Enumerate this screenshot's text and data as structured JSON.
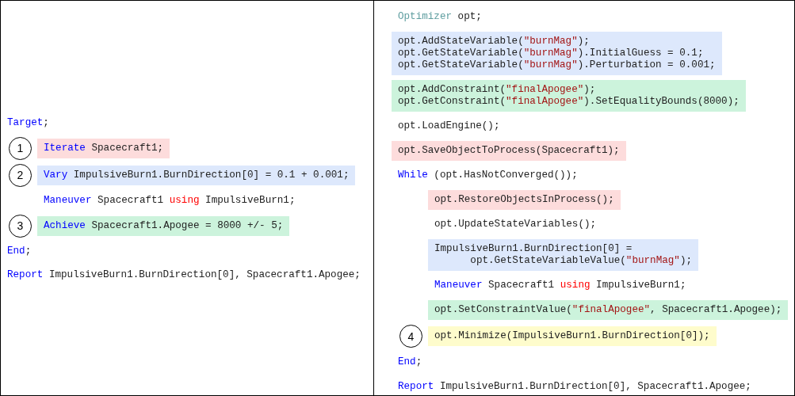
{
  "panels": [
    {
      "blocks": [
        {
          "lines": [
            [
              {
                "text": "Target",
                "kind": "keyword"
              },
              {
                "text": ";",
                "kind": "plain"
              }
            ]
          ],
          "children": [
            {
              "step": "1",
              "color": "#fddcdc",
              "lines": [
                [
                  {
                    "text": "Iterate",
                    "kind": "keyword"
                  },
                  {
                    "text": " Spacecraft1;",
                    "kind": "plain"
                  }
                ]
              ]
            },
            {
              "step": "2",
              "color": "#dde8fc",
              "lines": [
                [
                  {
                    "text": "Vary",
                    "kind": "keyword"
                  },
                  {
                    "text": " ImpulsiveBurn1.BurnDirection[0] = 0.1 + 0.001;",
                    "kind": "plain"
                  }
                ]
              ]
            },
            {
              "lines": [
                [
                  {
                    "text": "Maneuver",
                    "kind": "keyword"
                  },
                  {
                    "text": " Spacecraft1 ",
                    "kind": "plain"
                  },
                  {
                    "text": "using",
                    "kind": "operator"
                  },
                  {
                    "text": " ImpulsiveBurn1;",
                    "kind": "plain"
                  }
                ]
              ]
            },
            {
              "step": "3",
              "color": "#ccf3dc",
              "lines": [
                [
                  {
                    "text": "Achieve",
                    "kind": "keyword"
                  },
                  {
                    "text": " Spacecraft1.Apogee = 8000 +/- 5;",
                    "kind": "plain"
                  }
                ]
              ]
            }
          ]
        },
        {
          "lines": [
            [
              {
                "text": "End",
                "kind": "keyword"
              },
              {
                "text": ";",
                "kind": "plain"
              }
            ]
          ]
        },
        {
          "lines": [
            [
              {
                "text": "Report",
                "kind": "keyword"
              },
              {
                "text": " ImpulsiveBurn1.BurnDirection[0], Spacecraft1.Apogee;",
                "kind": "plain"
              }
            ]
          ]
        }
      ]
    },
    {
      "blocks": [
        {
          "lines": [
            [
              {
                "text": "Optimizer",
                "kind": "type"
              },
              {
                "text": " opt;",
                "kind": "plain"
              }
            ]
          ]
        },
        {
          "color": "#dde8fc",
          "lines": [
            [
              {
                "text": "opt.AddStateVariable(",
                "kind": "plain"
              },
              {
                "text": "\"burnMag\"",
                "kind": "string"
              },
              {
                "text": ");",
                "kind": "plain"
              }
            ],
            [
              {
                "text": "opt.GetStateVariable(",
                "kind": "plain"
              },
              {
                "text": "\"burnMag\"",
                "kind": "string"
              },
              {
                "text": ").InitialGuess = 0.1;",
                "kind": "plain"
              }
            ],
            [
              {
                "text": "opt.GetStateVariable(",
                "kind": "plain"
              },
              {
                "text": "\"burnMag\"",
                "kind": "string"
              },
              {
                "text": ").Perturbation = 0.001;",
                "kind": "plain"
              }
            ]
          ]
        },
        {
          "color": "#ccf3dc",
          "lines": [
            [
              {
                "text": "opt.AddConstraint(",
                "kind": "plain"
              },
              {
                "text": "\"finalApogee\"",
                "kind": "string"
              },
              {
                "text": ");",
                "kind": "plain"
              }
            ],
            [
              {
                "text": "opt.GetConstraint(",
                "kind": "plain"
              },
              {
                "text": "\"finalApogee\"",
                "kind": "string"
              },
              {
                "text": ").SetEqualityBounds(8000);",
                "kind": "plain"
              }
            ]
          ]
        },
        {
          "lines": [
            [
              {
                "text": "opt.LoadEngine();",
                "kind": "plain"
              }
            ]
          ]
        },
        {
          "color": "#fddcdc",
          "lines": [
            [
              {
                "text": "opt.SaveObjectToProcess(Spacecraft1);",
                "kind": "plain"
              }
            ]
          ]
        },
        {
          "lines": [
            [
              {
                "text": "While",
                "kind": "keyword"
              },
              {
                "text": " (opt.HasNotConverged());",
                "kind": "plain"
              }
            ]
          ],
          "children": [
            {
              "color": "#fddcdc",
              "lines": [
                [
                  {
                    "text": "opt.RestoreObjectsInProcess();",
                    "kind": "plain"
                  }
                ]
              ]
            },
            {
              "lines": [
                [
                  {
                    "text": "opt.UpdateStateVariables();",
                    "kind": "plain"
                  }
                ]
              ]
            },
            {
              "color": "#dde8fc",
              "lines": [
                [
                  {
                    "text": "ImpulsiveBurn1.BurnDirection[0] =",
                    "kind": "plain"
                  }
                ],
                [
                  {
                    "text": "      opt.GetStateVariableValue(",
                    "kind": "plain"
                  },
                  {
                    "text": "\"burnMag\"",
                    "kind": "string"
                  },
                  {
                    "text": ");",
                    "kind": "plain"
                  }
                ]
              ]
            },
            {
              "lines": [
                [
                  {
                    "text": "Maneuver",
                    "kind": "keyword"
                  },
                  {
                    "text": " Spacecraft1 ",
                    "kind": "plain"
                  },
                  {
                    "text": "using",
                    "kind": "operator"
                  },
                  {
                    "text": " ImpulsiveBurn1;",
                    "kind": "plain"
                  }
                ]
              ]
            },
            {
              "color": "#ccf3dc",
              "lines": [
                [
                  {
                    "text": "opt.SetConstraintValue(",
                    "kind": "plain"
                  },
                  {
                    "text": "\"finalApogee\"",
                    "kind": "string"
                  },
                  {
                    "text": ", Spacecraft1.Apogee);",
                    "kind": "plain"
                  }
                ]
              ]
            },
            {
              "step": "4",
              "color": "#fefccc",
              "lines": [
                [
                  {
                    "text": "opt.Minimize(ImpulsiveBurn1.BurnDirection[0]);",
                    "kind": "plain"
                  }
                ]
              ]
            }
          ]
        },
        {
          "lines": [
            [
              {
                "text": "End",
                "kind": "keyword"
              },
              {
                "text": ";",
                "kind": "plain"
              }
            ]
          ]
        },
        {
          "lines": [
            [
              {
                "text": "Report",
                "kind": "keyword"
              },
              {
                "text": " ImpulsiveBurn1.BurnDirection[0], Spacecraft1.Apogee;",
                "kind": "plain"
              }
            ]
          ]
        }
      ]
    }
  ]
}
